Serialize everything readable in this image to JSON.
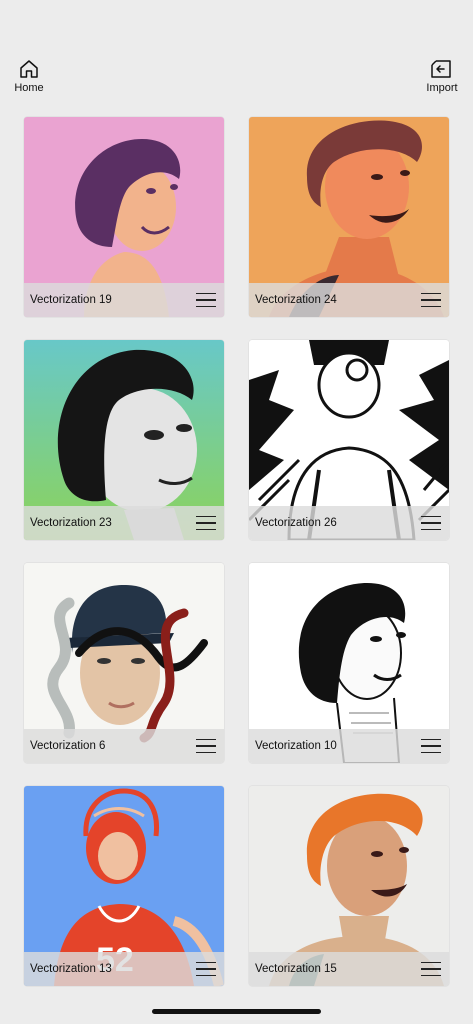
{
  "toolbar": {
    "home_label": "Home",
    "import_label": "Import"
  },
  "gallery": {
    "items": [
      {
        "title": "Vectorization 19",
        "bg": "#eaa3d1"
      },
      {
        "title": "Vectorization 24",
        "bg": "#eea45a"
      },
      {
        "title": "Vectorization 23",
        "bg": "#6cc6b0"
      },
      {
        "title": "Vectorization 26",
        "bg": "#ffffff"
      },
      {
        "title": "Vectorization 6",
        "bg": "#f6f6f3"
      },
      {
        "title": "Vectorization 10",
        "bg": "#ffffff"
      },
      {
        "title": "Vectorization 13",
        "bg": "#6aa0f2"
      },
      {
        "title": "Vectorization 15",
        "bg": "#ededeb"
      }
    ]
  },
  "icons": {
    "home": "house-outline-icon",
    "import": "import-file-icon",
    "card_menu": "hamburger-menu-icon"
  }
}
